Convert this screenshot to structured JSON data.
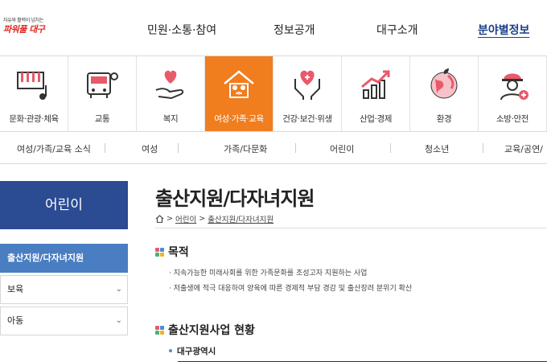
{
  "header": {
    "logo_tagline": "자유와 활력이 넘치는",
    "logo_brand": "파워풀 대구",
    "nav": [
      {
        "label": "민원·소통·참여"
      },
      {
        "label": "정보공개"
      },
      {
        "label": "대구소개"
      },
      {
        "label": "분야별정보"
      }
    ]
  },
  "categories": [
    {
      "label": "문화·관광·체육",
      "icon": "piano-music-icon"
    },
    {
      "label": "교통",
      "icon": "bus-icon"
    },
    {
      "label": "복지",
      "icon": "heart-hand-icon"
    },
    {
      "label": "여성·가족·교육",
      "icon": "family-house-icon"
    },
    {
      "label": "건강·보건·위생",
      "icon": "heart-hands-icon"
    },
    {
      "label": "산업·경제",
      "icon": "growth-chart-icon"
    },
    {
      "label": "환경",
      "icon": "earth-leaf-icon"
    },
    {
      "label": "소방·안전",
      "icon": "firefighter-icon"
    }
  ],
  "submenu": [
    {
      "label": "여성/가족/교육 소식"
    },
    {
      "label": "여성"
    },
    {
      "label": "가족/다문화"
    },
    {
      "label": "어린이"
    },
    {
      "label": "청소년"
    },
    {
      "label": "교육/공연/"
    }
  ],
  "sidebar": {
    "title": "어린이",
    "items": [
      {
        "label": "출산지원/다자녀지원"
      },
      {
        "label": "보육"
      },
      {
        "label": "아동"
      }
    ]
  },
  "content": {
    "title": "출산지원/다자녀지원",
    "breadcrumb": [
      "어린이",
      "출산지원/다자녀지원"
    ],
    "section1": {
      "heading": "목적",
      "bullets": [
        "지속가능한 미래사회를 위한 가족문화를 조성고자 지원하는 사업",
        "저출생에 적극 대응하여 양육에 따른 경제적 부담 경감 및 출산장려 분위기 확산"
      ]
    },
    "section2": {
      "heading": "출산지원사업 현황",
      "sub": "대구광역시"
    }
  },
  "colors": {
    "active_category": "#f07d1e",
    "sidebar_title": "#2b4b93",
    "sidebar_active": "#4a7ec2",
    "brand_red": "#e02a20"
  }
}
